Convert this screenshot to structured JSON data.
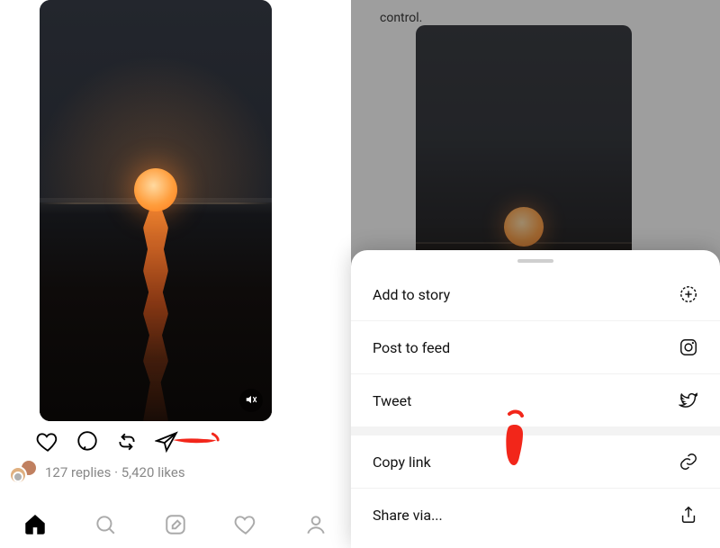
{
  "left": {
    "mute_icon": "muted-icon",
    "actions": {
      "like": "like-button",
      "comment": "comment-button",
      "repost": "repost-button",
      "share": "share-button"
    },
    "stats": {
      "replies_count": "127",
      "replies_label": "replies",
      "sep": " · ",
      "likes_count": "5,420",
      "likes_label": "likes"
    },
    "nav": {
      "home": "home-tab",
      "search": "search-tab",
      "compose": "compose-tab",
      "activity": "activity-tab",
      "profile": "profile-tab"
    }
  },
  "right": {
    "snippet": "control.",
    "sheet": {
      "add_to_story": "Add to story",
      "post_to_feed": "Post to feed",
      "tweet": "Tweet",
      "copy_link": "Copy link",
      "share_via": "Share via..."
    }
  }
}
